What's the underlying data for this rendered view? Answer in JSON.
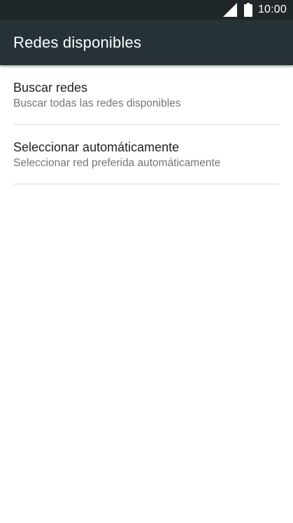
{
  "status_bar": {
    "time": "10:00",
    "signal_icon": "cell-signal-icon",
    "battery_icon": "battery-icon"
  },
  "app_bar": {
    "title": "Redes disponibles"
  },
  "list": {
    "items": [
      {
        "title": "Buscar redes",
        "summary": "Buscar todas las redes disponibles"
      },
      {
        "title": "Seleccionar automáticamente",
        "summary": "Seleccionar red preferida automáticamente"
      }
    ]
  },
  "colors": {
    "status_bar_bg": "#1f272b",
    "app_bar_bg": "#263238",
    "primary_text": "#212121",
    "secondary_text": "#757575",
    "divider": "#dcdcdc"
  }
}
